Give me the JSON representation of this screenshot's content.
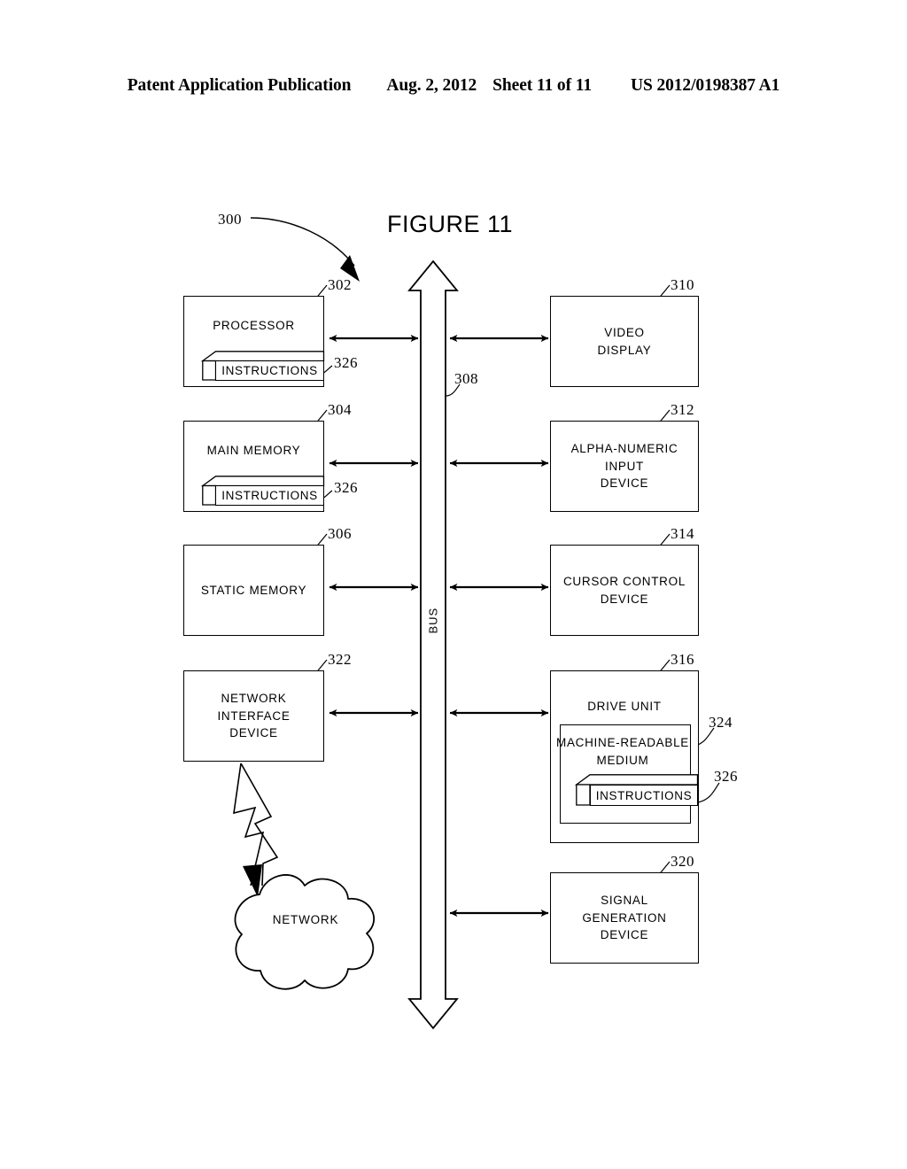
{
  "header": {
    "publication": "Patent Application Publication",
    "date": "Aug. 2, 2012",
    "sheet": "Sheet 11 of 11",
    "number": "US 2012/0198387 A1"
  },
  "figure": {
    "title": "FIGURE 11",
    "system_ref": "300"
  },
  "bus": {
    "label": "BUS",
    "ref": "308"
  },
  "left_blocks": [
    {
      "name": "processor",
      "label": "PROCESSOR",
      "ref": "302",
      "sub": {
        "label": "INSTRUCTIONS",
        "ref": "326"
      }
    },
    {
      "name": "main-memory",
      "label": "MAIN MEMORY",
      "ref": "304",
      "sub": {
        "label": "INSTRUCTIONS",
        "ref": "326"
      }
    },
    {
      "name": "static-memory",
      "label": "STATIC MEMORY",
      "ref": "306",
      "sub": null
    },
    {
      "name": "network-interface-device",
      "label": "NETWORK\nINTERFACE\nDEVICE",
      "ref": "322",
      "sub": null
    }
  ],
  "right_blocks": [
    {
      "name": "video-display",
      "label": "VIDEO\nDISPLAY",
      "ref": "310"
    },
    {
      "name": "alpha-numeric-input-device",
      "label": "ALPHA-NUMERIC\nINPUT\nDEVICE",
      "ref": "312"
    },
    {
      "name": "cursor-control-device",
      "label": "CURSOR CONTROL\nDEVICE",
      "ref": "314"
    },
    {
      "name": "drive-unit",
      "label": "DRIVE UNIT",
      "ref": "316",
      "medium": {
        "label": "MACHINE-READABLE\nMEDIUM",
        "ref": "324"
      },
      "sub": {
        "label": "INSTRUCTIONS",
        "ref": "326"
      }
    },
    {
      "name": "signal-generation-device",
      "label": "SIGNAL\nGENERATION\nDEVICE",
      "ref": "320"
    }
  ],
  "network": {
    "label": "NETWORK"
  },
  "colors": {
    "ink": "#000000",
    "paper": "#ffffff"
  }
}
